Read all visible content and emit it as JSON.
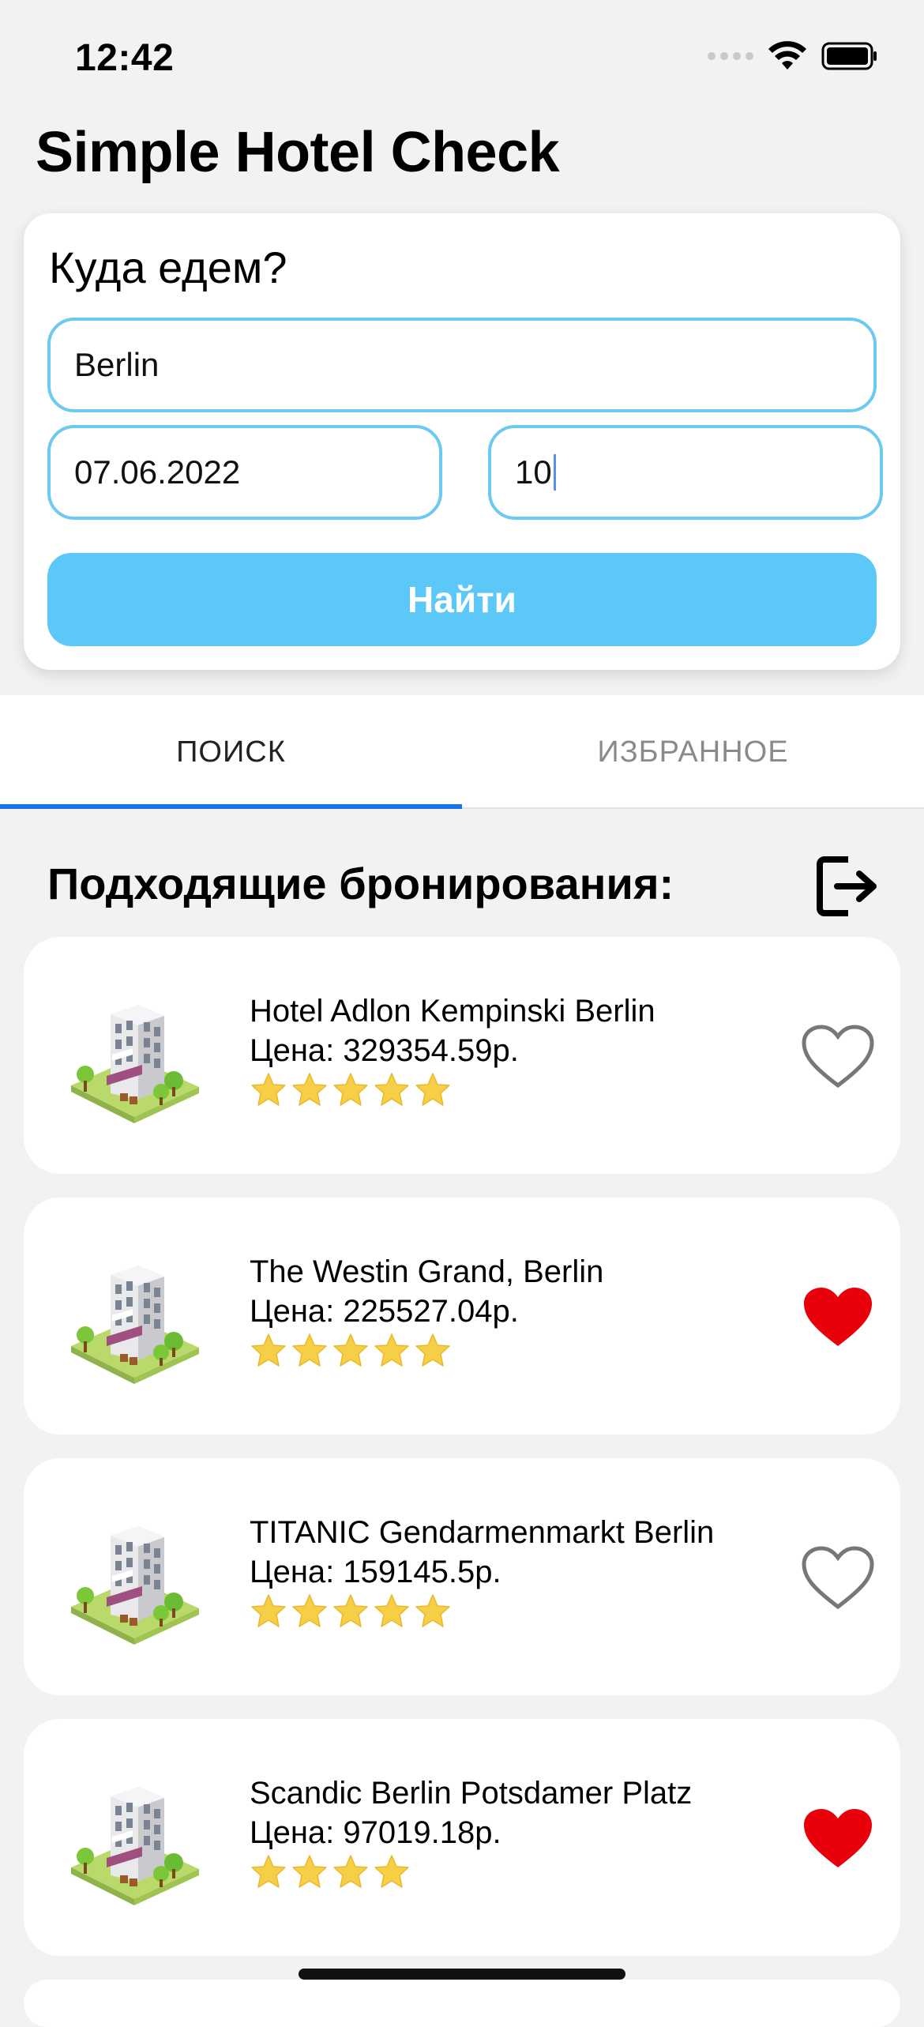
{
  "status": {
    "time": "12:42"
  },
  "app": {
    "title": "Simple Hotel Check"
  },
  "search": {
    "heading": "Куда едем?",
    "city_value": "Berlin",
    "date_value": "07.06.2022",
    "nights_value": "10",
    "button_label": "Найти",
    "accent_color": "#5bc8f8"
  },
  "tabs": [
    {
      "label": "ПОИСК",
      "active": true
    },
    {
      "label": "ИЗБРАННОЕ",
      "active": false
    }
  ],
  "results": {
    "title": "Подходящие бронирования:",
    "hotels": [
      {
        "name": "Hotel Adlon Kempinski Berlin",
        "price": "Цена: 329354.59р.",
        "stars": 5,
        "favorite": false,
        "icon": "hotel-building-icon"
      },
      {
        "name": "The Westin Grand, Berlin",
        "price": "Цена: 225527.04р.",
        "stars": 5,
        "favorite": true,
        "icon": "hotel-building-icon"
      },
      {
        "name": "TITANIC Gendarmenmarkt Berlin",
        "price": "Цена: 159145.5р.",
        "stars": 5,
        "favorite": false,
        "icon": "hotel-building-icon"
      },
      {
        "name": "Scandic Berlin Potsdamer Platz",
        "price": "Цена: 97019.18р.",
        "stars": 4,
        "favorite": true,
        "icon": "hotel-building-icon"
      }
    ]
  },
  "colors": {
    "star": "#f6cf47",
    "favorite_active": "#e8000b",
    "favorite_inactive": "#777777",
    "tab_indicator": "#1a73e8"
  }
}
